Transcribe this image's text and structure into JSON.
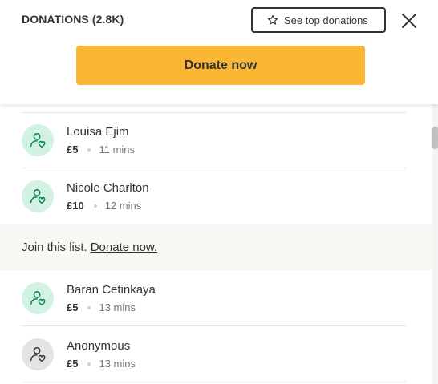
{
  "header": {
    "title": "DONATIONS (2.8K)",
    "top_button_label": "See top donations",
    "top_button_icon": "star-icon",
    "close_icon": "close-icon",
    "donate_button_label": "Donate now",
    "donate_button_color": "#fbb634"
  },
  "donations": [
    {
      "name": "Louisa Ejim",
      "amount": "£5",
      "time": "11 mins",
      "icon": "heart-user-icon"
    },
    {
      "name": "Nicole Charlton",
      "amount": "£10",
      "time": "12 mins",
      "icon": "heart-user-icon"
    }
  ],
  "join_banner": {
    "text": "Join this list.",
    "link": "Donate now."
  },
  "donations_after": [
    {
      "name": "Baran Cetinkaya",
      "amount": "£5",
      "time": "13 mins",
      "icon": "heart-user-icon"
    },
    {
      "name": "Anonymous",
      "amount": "£5",
      "time": "13 mins",
      "icon": "heart-user-icon"
    }
  ],
  "colors": {
    "avatar_green": "#d3f2e3",
    "avatar_icon_green": "#028748",
    "avatar_grey": "#e3e3e3",
    "banner_bg": "#f9f7f3"
  }
}
